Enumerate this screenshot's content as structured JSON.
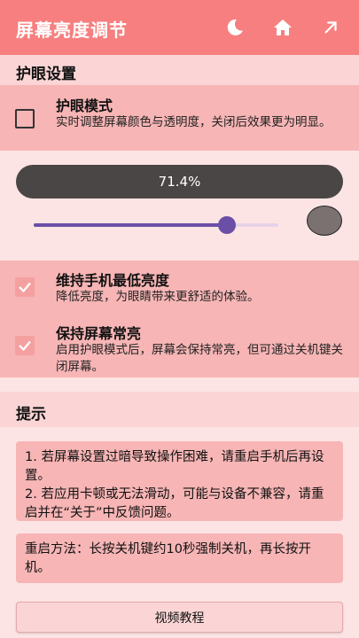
{
  "appbar": {
    "title": "屏幕亮度调节",
    "icons": [
      "moon-icon",
      "home-icon",
      "arrow-up-right-icon"
    ]
  },
  "eye_protection": {
    "section_title": "护眼设置",
    "mode_title": "护眼模式",
    "mode_desc": "实时调整屏幕颜色与透明度，关闭后效果更为明显。",
    "mode_checked": false,
    "brightness_label": "71.4%",
    "slider_value": 0.79,
    "swatch_color": "#7a7170",
    "min_brightness_title": "维持手机最低亮度",
    "min_brightness_desc": "降低亮度，为眼睛带来更舒适的体验。",
    "min_brightness_checked": true,
    "keep_on_title": "保持屏幕常亮",
    "keep_on_desc": "启用护眼模式后，屏幕会保持常亮，但可通过关机键关闭屏幕。",
    "keep_on_checked": true
  },
  "tips": {
    "section_title": "提示",
    "tip1": "1. 若屏幕设置过暗导致操作困难，请重启手机后再设置。\n2. 若应用卡顿或无法滑动，可能与设备不兼容，请重启并在“关于”中反馈问题。",
    "tip2": "重启方法：长按关机键约10秒强制关机，再长按开机。",
    "video_button": "视频教程"
  },
  "colors": {
    "appbar": "#f77f7f",
    "background": "#fbd5d5",
    "panel_dark": "#f7b5b5",
    "panel_light": "#fde4e4",
    "accent": "#6b4ea6"
  }
}
